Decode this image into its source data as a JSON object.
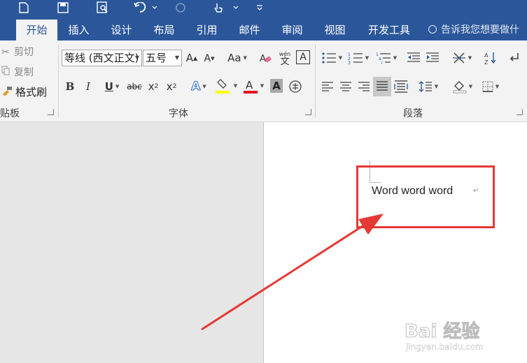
{
  "tabs": [
    {
      "label": "开始",
      "active": true
    },
    {
      "label": "插入"
    },
    {
      "label": "设计"
    },
    {
      "label": "布局"
    },
    {
      "label": "引用"
    },
    {
      "label": "邮件"
    },
    {
      "label": "审阅"
    },
    {
      "label": "视图"
    },
    {
      "label": "开发工具"
    }
  ],
  "tell_me": "告诉我您想要做什",
  "clipboard": {
    "cut": "剪切",
    "copy": "复制",
    "format_painter": "格式刷",
    "label": "贴板"
  },
  "font": {
    "name": "等线 (西文正文)",
    "size": "五号",
    "label": "字体",
    "phonetic_top": "wén",
    "phonetic_bottom": "文",
    "highlight_color": "#ffff00",
    "font_color": "#e81123"
  },
  "paragraph": {
    "label": "段落"
  },
  "document": {
    "text": "Word word word",
    "para_mark": "↵"
  },
  "annotation": {
    "color": "#e53935"
  },
  "watermark": {
    "logo": "Bai 经验",
    "url": "jingyan.baidu.com"
  },
  "colors": {
    "accent": "#2b579a",
    "ribbon": "#f3f3f3"
  }
}
